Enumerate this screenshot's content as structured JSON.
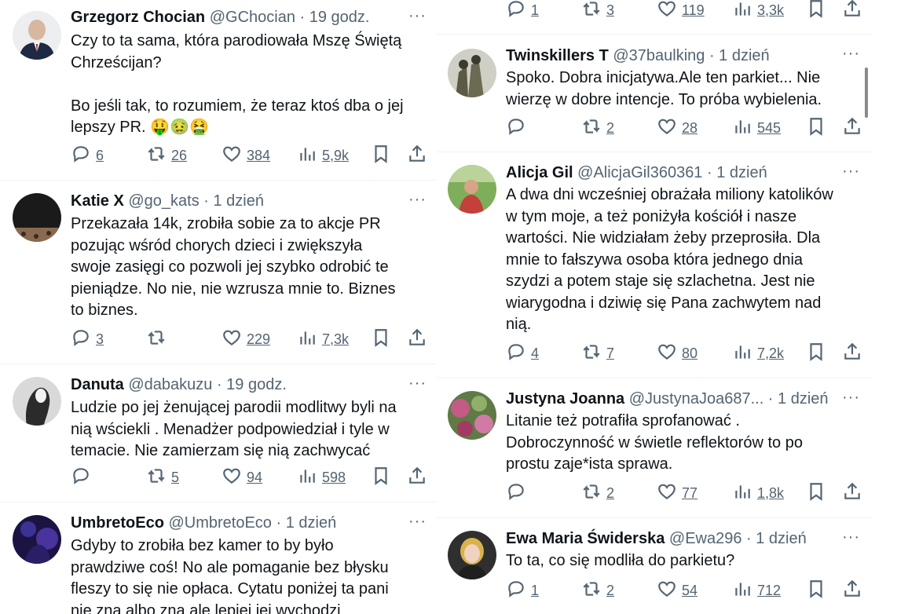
{
  "icons": {
    "reply": "reply-icon",
    "retweet": "retweet-icon",
    "like": "like-icon",
    "views": "views-icon",
    "bookmark": "bookmark-icon",
    "share": "share-icon",
    "more": "more-icon"
  },
  "more_glyph": "···",
  "left": [
    {
      "name": "Grzegorz Chocian",
      "meta": "@GChocian · 19 godz.",
      "text": "Czy to ta sama, która parodiowała Mszę Świętą\nChrześcijan?\n\nBo jeśli tak, to rozumiem, że teraz ktoś dba o jej\nlepszy PR. 🤑🤢🤮",
      "replies": "6",
      "retweets": "26",
      "likes": "384",
      "views": "5,9k"
    },
    {
      "name": "Katie X",
      "meta": "@go_kats · 1 dzień",
      "text": "Przekazała 14k, zrobiła sobie za to akcje PR\npozując wśród chorych dzieci i zwiększyła\nswoje zasięgi co pozwoli jej szybko odrobić te\npieniądze. No nie, nie wzrusza mnie to. Biznes\nto biznes.",
      "replies": "3",
      "retweets": "",
      "likes": "229",
      "views": "7,3k"
    },
    {
      "name": "Danuta",
      "meta": "@dabakuzu · 19 godz.",
      "text": "Ludzie po jej żenującej parodii modlitwy byli na\nnią wściekli .  Menadżer podpowiedział i tyle w\ntemacie. Nie zamierzam się nią zachwycać",
      "replies": "",
      "retweets": "5",
      "likes": "94",
      "views": "598"
    },
    {
      "name": "UmbretoEco",
      "meta": "@UmbretoEco · 1 dzień",
      "text": "Gdyby to zrobiła bez kamer to by było\nprawdziwe coś! No ale pomaganie bez błysku\nfleszy to się nie opłaca. Cytatu poniżej ta pani\nnie zna albo zna ale lepiej jej wychodzi",
      "replies": "",
      "retweets": "",
      "likes": "",
      "views": ""
    }
  ],
  "right": [
    {
      "name": "",
      "meta": "",
      "text": "",
      "replies": "1",
      "retweets": "3",
      "likes": "119",
      "views": "3,3k"
    },
    {
      "name": "Twinskillers T",
      "meta": "@37baulking · 1 dzień",
      "text": "Spoko. Dobra inicjatywa.Ale ten parkiet... Nie\nwierzę w dobre intencje. To próba wybielenia.",
      "replies": "",
      "retweets": "2",
      "likes": "28",
      "views": "545"
    },
    {
      "name": "Alicja Gil",
      "meta": "@AlicjaGil360361 · 1 dzień",
      "text": "A dwa dni wcześniej obrażała miliony katolików\nw tym moje, a też poniżyła kościół i nasze\nwartości. Nie widziałam żeby przeprosiła. Dla\nmnie to fałszywa osoba która jednego dnia\nszydzi a potem staje się szlachetna. Jest nie\nwiarygodna i dziwię się Pana zachwytem nad\nnią.",
      "replies": "4",
      "retweets": "7",
      "likes": "80",
      "views": "7,2k"
    },
    {
      "name": "Justyna Joanna",
      "meta": "@JustynaJoa687... · 1 dzień",
      "text": "Litanie też potrafiła sprofanować .\nDobroczynność w świetle reflektorów to po\nprostu zaje*ista sprawa.",
      "replies": "",
      "retweets": "2",
      "likes": "77",
      "views": "1,8k"
    },
    {
      "name": "Ewa Maria Świderska",
      "meta": "@Ewa296 · 1 dzień",
      "text": "To ta, co się modliła do parkietu?",
      "replies": "1",
      "retweets": "2",
      "likes": "54",
      "views": "712"
    }
  ]
}
